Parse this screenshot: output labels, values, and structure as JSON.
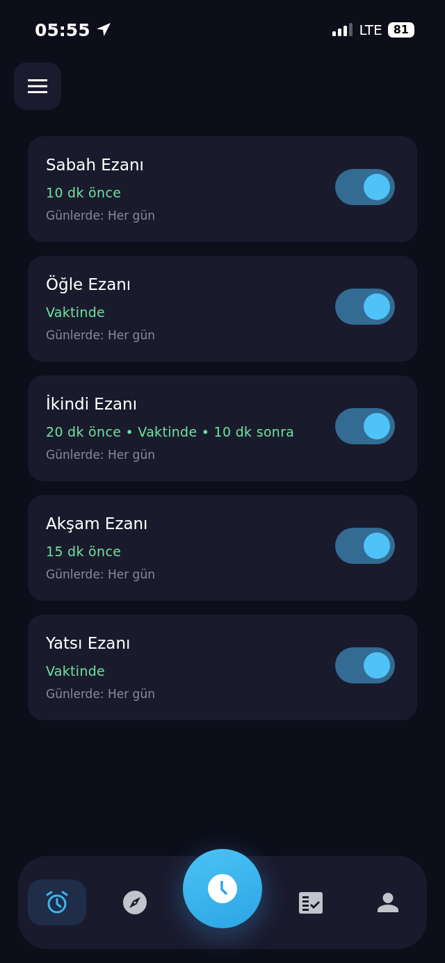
{
  "status_bar": {
    "time": "05:55",
    "network": "LTE",
    "battery": "81"
  },
  "alarms": [
    {
      "name": "Sabah Ezanı",
      "timing": "10 dk önce",
      "days": "Günlerde: Her gün",
      "on": true
    },
    {
      "name": "Öğle Ezanı",
      "timing": "Vaktinde",
      "days": "Günlerde: Her gün",
      "on": true
    },
    {
      "name": "İkindi Ezanı",
      "timing": "20 dk önce • Vaktinde • 10 dk sonra",
      "days": "Günlerde: Her gün",
      "on": true
    },
    {
      "name": "Akşam Ezanı",
      "timing": "15 dk önce",
      "days": "Günlerde: Her gün",
      "on": true
    },
    {
      "name": "Yatsı Ezanı",
      "timing": "Vaktinde",
      "days": "Günlerde: Her gün",
      "on": true
    }
  ],
  "nav": [
    {
      "kind": "alarm",
      "selected": true
    },
    {
      "kind": "compass",
      "selected": false
    },
    {
      "kind": "clock",
      "selected": false
    },
    {
      "kind": "checklist",
      "selected": false
    },
    {
      "kind": "profile",
      "selected": false
    }
  ]
}
